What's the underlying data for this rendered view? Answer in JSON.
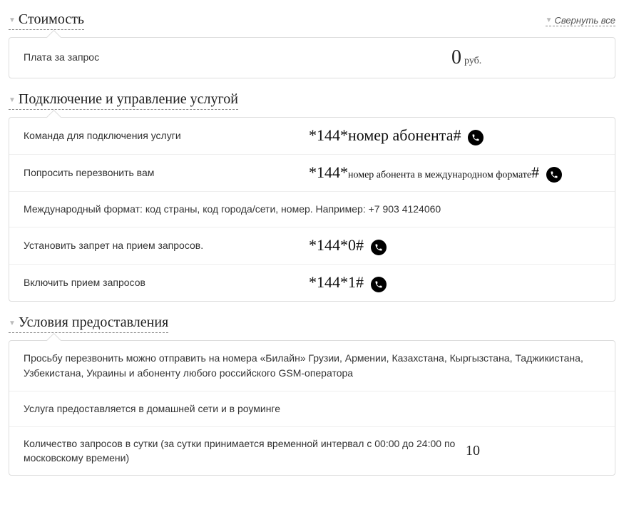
{
  "collapse_all": "Свернуть все",
  "sections": {
    "cost": {
      "title": "Стоимость",
      "rows": {
        "fee": {
          "label": "Плата за запрос",
          "value": "0",
          "unit": "руб."
        }
      }
    },
    "connect": {
      "title": "Подключение и управление услугой",
      "rows": {
        "cmd": {
          "label": "Команда для подключения услуги",
          "code_prefix": "*144*",
          "code_var": "номер абонента",
          "code_suffix": "#"
        },
        "callback": {
          "label": "Попросить перезвонить вам",
          "code_prefix": "*144*",
          "code_var": "номер абонента в международном формате",
          "code_suffix": "#"
        },
        "intl_format": "Международный формат: код страны, код города/сети, номер. Например: +7 903 4124060",
        "block": {
          "label": "Установить запрет на прием запросов.",
          "code": "*144*0#"
        },
        "unblock": {
          "label": "Включить прием запросов",
          "code": "*144*1#"
        }
      }
    },
    "terms": {
      "title": "Условия предоставления",
      "rows": {
        "countries": "Просьбу перезвонить можно отправить на номера «Билайн» Грузии, Армении, Казахстана, Кыргызстана, Таджикистана, Узбекистана, Украины и абоненту любого российского GSM-оператора",
        "roaming": "Услуга предоставляется в домашней сети и в роуминге",
        "limit": {
          "label": "Количество запросов в сутки (за сутки принимается временной интервал с 00:00 до 24:00 по московскому времени)",
          "value": "10"
        }
      }
    }
  }
}
